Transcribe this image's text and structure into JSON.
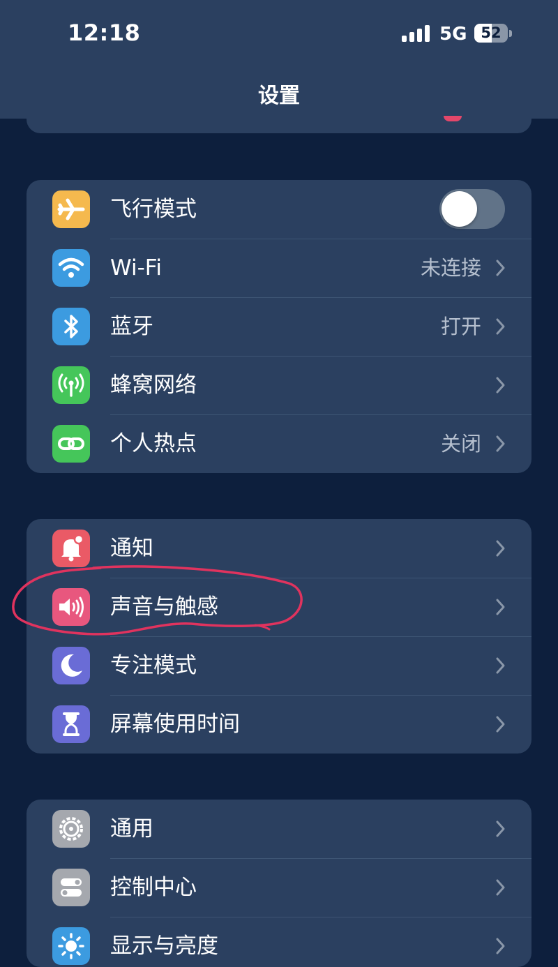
{
  "status_bar": {
    "time": "12:18",
    "network": "5G",
    "battery_level": "52",
    "battery_fraction": 0.52
  },
  "nav": {
    "title": "设置"
  },
  "groups": [
    {
      "rows": [
        {
          "label": "飞行模式",
          "icon": "airplane-icon",
          "icon_color": "#f5b94e",
          "control": "toggle",
          "toggle_on": false
        },
        {
          "label": "Wi-Fi",
          "icon": "wifi-icon",
          "icon_color": "#3c9be0",
          "value": "未连接"
        },
        {
          "label": "蓝牙",
          "icon": "bluetooth-icon",
          "icon_color": "#3c9be0",
          "value": "打开"
        },
        {
          "label": "蜂窝网络",
          "icon": "antenna-icon",
          "icon_color": "#45c65a",
          "value": ""
        },
        {
          "label": "个人热点",
          "icon": "chain-link-icon",
          "icon_color": "#45c65a",
          "value": "关闭"
        }
      ]
    },
    {
      "rows": [
        {
          "label": "通知",
          "icon": "bell-icon",
          "icon_color": "#ea5a66",
          "value": ""
        },
        {
          "label": "声音与触感",
          "icon": "speaker-icon",
          "icon_color": "#e8577e",
          "value": ""
        },
        {
          "label": "专注模式",
          "icon": "moon-icon",
          "icon_color": "#6a6cd6",
          "value": ""
        },
        {
          "label": "屏幕使用时间",
          "icon": "hourglass-icon",
          "icon_color": "#6a6cd6",
          "value": ""
        }
      ]
    },
    {
      "rows": [
        {
          "label": "通用",
          "icon": "gear-icon",
          "icon_color": "#a5a8ae",
          "value": ""
        },
        {
          "label": "控制中心",
          "icon": "switches-icon",
          "icon_color": "#a5a8ae",
          "value": ""
        },
        {
          "label": "显示与亮度",
          "icon": "sun-icon",
          "icon_color": "#3c9be0",
          "value": ""
        }
      ]
    }
  ],
  "colors": {
    "background": "#0d1f3d",
    "card": "#2b4060",
    "separator": "#3e5574",
    "secondary_text": "#b6c0cf",
    "annotation": "#e0335e"
  }
}
